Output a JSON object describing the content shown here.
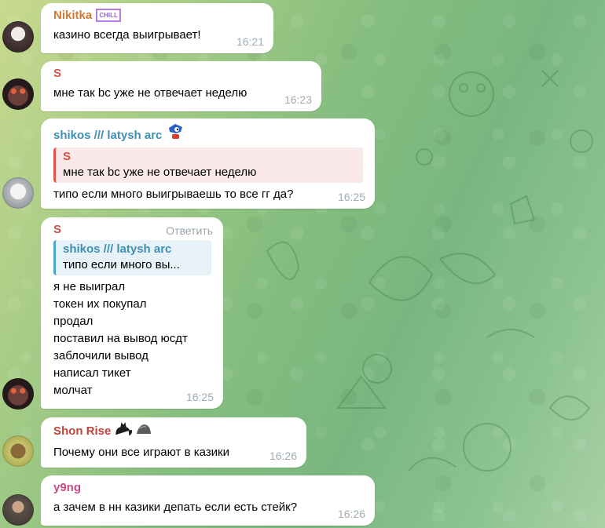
{
  "colors": {
    "name_nikitka": "#d27a34",
    "name_s": "#d6503f",
    "name_shikos": "#3e8fb3",
    "name_shon": "#c0443b",
    "name_y9ng": "#c84a84",
    "quote_red_bg": "#fbe8e8",
    "quote_red_bar": "#e4534d",
    "quote_blue_bg": "#e6f2f8",
    "quote_blue_bar": "#4fa4cf"
  },
  "messages": [
    {
      "author": "Nikitka",
      "badge": "CHILL",
      "lines": [
        "казино всегда выигрывает!"
      ],
      "time": "16:21"
    },
    {
      "author": "S",
      "lines": [
        "мне так bc уже не отвечает неделю"
      ],
      "time": "16:23"
    },
    {
      "author": "shikos /// latysh arc",
      "reply": {
        "author": "S",
        "text": "мне так bc уже не отвечает неделю"
      },
      "lines": [
        "типо если много выигрываешь то все гг да?"
      ],
      "time": "16:25"
    },
    {
      "author": "S",
      "reply_action": "Ответить",
      "reply": {
        "author": "shikos /// latysh arc",
        "text": "типо если много вы..."
      },
      "lines": [
        "я не выиграл",
        "токен их покупал",
        "продал",
        "поставил на вывод юсдт",
        "заблочили вывод",
        "написал тикет",
        "молчат"
      ],
      "time": "16:25"
    },
    {
      "author": "Shon Rise",
      "lines": [
        "Почему они все играют в казики"
      ],
      "time": "16:26"
    },
    {
      "author": "y9ng",
      "lines": [
        "а зачем в нн казики депать если есть стейк?"
      ],
      "time": "16:26"
    }
  ]
}
